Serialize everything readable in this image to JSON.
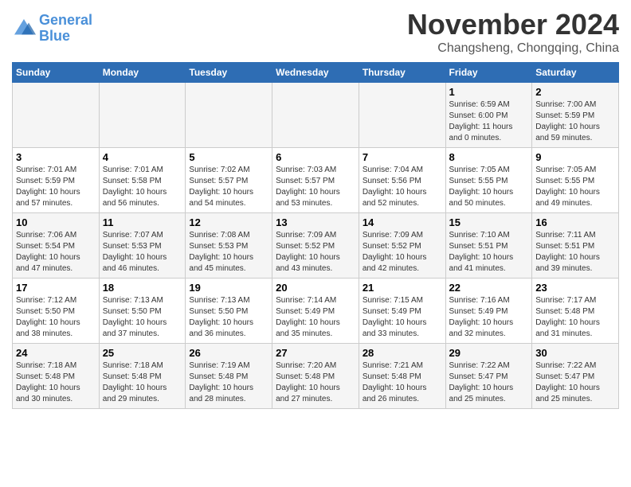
{
  "logo": {
    "line1": "General",
    "line2": "Blue"
  },
  "title": "November 2024",
  "location": "Changsheng, Chongqing, China",
  "weekdays": [
    "Sunday",
    "Monday",
    "Tuesday",
    "Wednesday",
    "Thursday",
    "Friday",
    "Saturday"
  ],
  "weeks": [
    [
      {
        "day": "",
        "info": ""
      },
      {
        "day": "",
        "info": ""
      },
      {
        "day": "",
        "info": ""
      },
      {
        "day": "",
        "info": ""
      },
      {
        "day": "",
        "info": ""
      },
      {
        "day": "1",
        "info": "Sunrise: 6:59 AM\nSunset: 6:00 PM\nDaylight: 11 hours\nand 0 minutes."
      },
      {
        "day": "2",
        "info": "Sunrise: 7:00 AM\nSunset: 5:59 PM\nDaylight: 10 hours\nand 59 minutes."
      }
    ],
    [
      {
        "day": "3",
        "info": "Sunrise: 7:01 AM\nSunset: 5:59 PM\nDaylight: 10 hours\nand 57 minutes."
      },
      {
        "day": "4",
        "info": "Sunrise: 7:01 AM\nSunset: 5:58 PM\nDaylight: 10 hours\nand 56 minutes."
      },
      {
        "day": "5",
        "info": "Sunrise: 7:02 AM\nSunset: 5:57 PM\nDaylight: 10 hours\nand 54 minutes."
      },
      {
        "day": "6",
        "info": "Sunrise: 7:03 AM\nSunset: 5:57 PM\nDaylight: 10 hours\nand 53 minutes."
      },
      {
        "day": "7",
        "info": "Sunrise: 7:04 AM\nSunset: 5:56 PM\nDaylight: 10 hours\nand 52 minutes."
      },
      {
        "day": "8",
        "info": "Sunrise: 7:05 AM\nSunset: 5:55 PM\nDaylight: 10 hours\nand 50 minutes."
      },
      {
        "day": "9",
        "info": "Sunrise: 7:05 AM\nSunset: 5:55 PM\nDaylight: 10 hours\nand 49 minutes."
      }
    ],
    [
      {
        "day": "10",
        "info": "Sunrise: 7:06 AM\nSunset: 5:54 PM\nDaylight: 10 hours\nand 47 minutes."
      },
      {
        "day": "11",
        "info": "Sunrise: 7:07 AM\nSunset: 5:53 PM\nDaylight: 10 hours\nand 46 minutes."
      },
      {
        "day": "12",
        "info": "Sunrise: 7:08 AM\nSunset: 5:53 PM\nDaylight: 10 hours\nand 45 minutes."
      },
      {
        "day": "13",
        "info": "Sunrise: 7:09 AM\nSunset: 5:52 PM\nDaylight: 10 hours\nand 43 minutes."
      },
      {
        "day": "14",
        "info": "Sunrise: 7:09 AM\nSunset: 5:52 PM\nDaylight: 10 hours\nand 42 minutes."
      },
      {
        "day": "15",
        "info": "Sunrise: 7:10 AM\nSunset: 5:51 PM\nDaylight: 10 hours\nand 41 minutes."
      },
      {
        "day": "16",
        "info": "Sunrise: 7:11 AM\nSunset: 5:51 PM\nDaylight: 10 hours\nand 39 minutes."
      }
    ],
    [
      {
        "day": "17",
        "info": "Sunrise: 7:12 AM\nSunset: 5:50 PM\nDaylight: 10 hours\nand 38 minutes."
      },
      {
        "day": "18",
        "info": "Sunrise: 7:13 AM\nSunset: 5:50 PM\nDaylight: 10 hours\nand 37 minutes."
      },
      {
        "day": "19",
        "info": "Sunrise: 7:13 AM\nSunset: 5:50 PM\nDaylight: 10 hours\nand 36 minutes."
      },
      {
        "day": "20",
        "info": "Sunrise: 7:14 AM\nSunset: 5:49 PM\nDaylight: 10 hours\nand 35 minutes."
      },
      {
        "day": "21",
        "info": "Sunrise: 7:15 AM\nSunset: 5:49 PM\nDaylight: 10 hours\nand 33 minutes."
      },
      {
        "day": "22",
        "info": "Sunrise: 7:16 AM\nSunset: 5:49 PM\nDaylight: 10 hours\nand 32 minutes."
      },
      {
        "day": "23",
        "info": "Sunrise: 7:17 AM\nSunset: 5:48 PM\nDaylight: 10 hours\nand 31 minutes."
      }
    ],
    [
      {
        "day": "24",
        "info": "Sunrise: 7:18 AM\nSunset: 5:48 PM\nDaylight: 10 hours\nand 30 minutes."
      },
      {
        "day": "25",
        "info": "Sunrise: 7:18 AM\nSunset: 5:48 PM\nDaylight: 10 hours\nand 29 minutes."
      },
      {
        "day": "26",
        "info": "Sunrise: 7:19 AM\nSunset: 5:48 PM\nDaylight: 10 hours\nand 28 minutes."
      },
      {
        "day": "27",
        "info": "Sunrise: 7:20 AM\nSunset: 5:48 PM\nDaylight: 10 hours\nand 27 minutes."
      },
      {
        "day": "28",
        "info": "Sunrise: 7:21 AM\nSunset: 5:48 PM\nDaylight: 10 hours\nand 26 minutes."
      },
      {
        "day": "29",
        "info": "Sunrise: 7:22 AM\nSunset: 5:47 PM\nDaylight: 10 hours\nand 25 minutes."
      },
      {
        "day": "30",
        "info": "Sunrise: 7:22 AM\nSunset: 5:47 PM\nDaylight: 10 hours\nand 25 minutes."
      }
    ]
  ]
}
